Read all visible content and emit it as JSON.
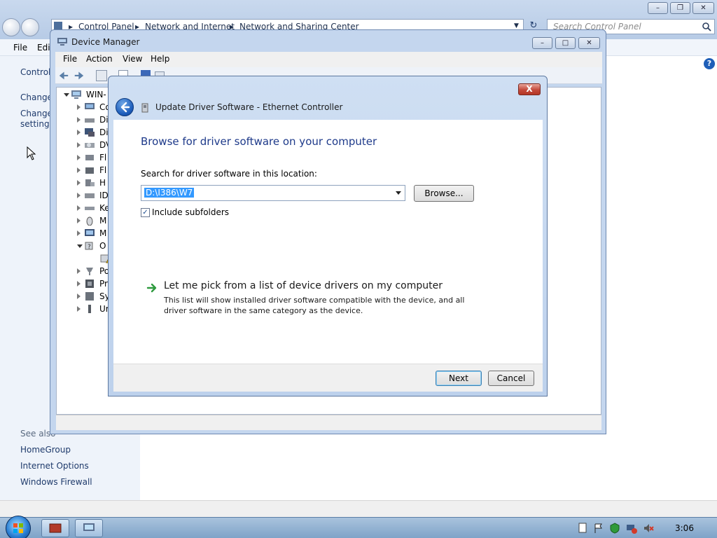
{
  "control_panel": {
    "breadcrumbs": [
      "Control Panel",
      "Network and Internet",
      "Network and Sharing Center"
    ],
    "search_placeholder": "Search Control Panel",
    "menu": [
      "File",
      "Edit"
    ],
    "sidebar_links": [
      "Control",
      "Change",
      "Change",
      "settings"
    ],
    "see_also_heading": "See also",
    "see_also_links": [
      "HomeGroup",
      "Internet Options",
      "Windows Firewall"
    ]
  },
  "device_manager": {
    "title": "Device Manager",
    "menu": [
      "File",
      "Action",
      "View",
      "Help"
    ],
    "tree_root": "WIN-",
    "tree_items": [
      "Co",
      "Di",
      "Di",
      "DV",
      "Fl",
      "Fl",
      "H",
      "ID",
      "Ke",
      "M",
      "M",
      "O",
      "",
      "Po",
      "Pr",
      "Sy",
      "Ur"
    ]
  },
  "dialog": {
    "title": "Update Driver Software - Ethernet Controller",
    "heading": "Browse for driver software on your computer",
    "search_label": "Search for driver software in this location:",
    "path_value": "D:\\I386\\W7",
    "browse_label": "Browse...",
    "include_subfolders_label": "Include subfolders",
    "include_subfolders_checked": true,
    "pick_link": "Let me pick from a list of device drivers on my computer",
    "pick_description": "This list will show installed driver software compatible with the device, and all driver software in the same category as the device.",
    "next_label": "Next",
    "cancel_label": "Cancel",
    "close_label": "X"
  },
  "taskbar": {
    "clock": "3:06"
  }
}
